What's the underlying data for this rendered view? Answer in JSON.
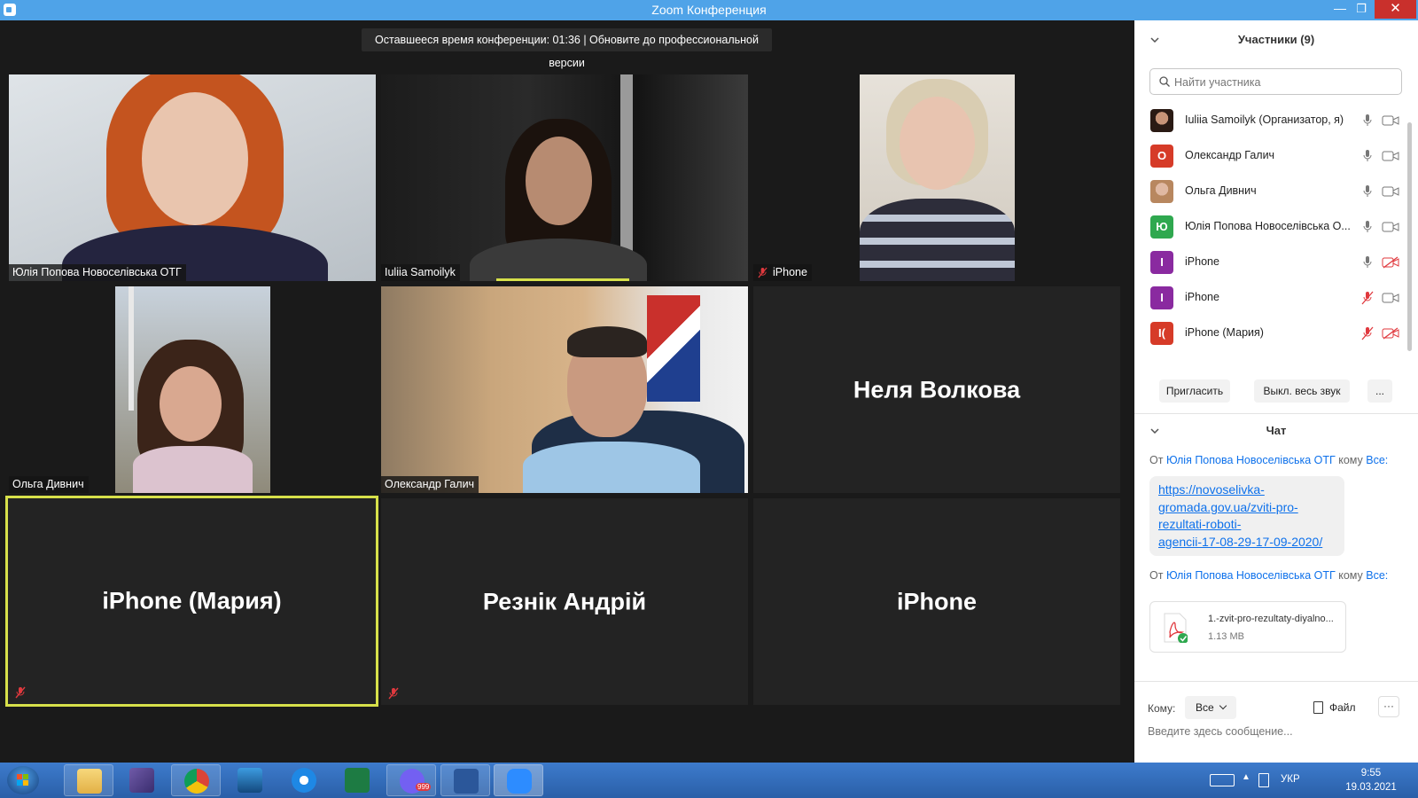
{
  "window": {
    "title": "Zoom Конференция",
    "minimize_glyph": "—",
    "maximize_glyph": "❐",
    "close_glyph": "✕"
  },
  "timebar": {
    "text": "Оставшееся время конференции: 01:36 | Обновите до профессиональной версии"
  },
  "tiles": [
    {
      "name": "Юлія Попова Новоселівська ОТГ",
      "type": "video"
    },
    {
      "name": "Iuliia Samoilyk",
      "type": "video"
    },
    {
      "name": "iPhone",
      "type": "video",
      "muted": true
    },
    {
      "name": "Ольга Дивнич",
      "type": "video"
    },
    {
      "name": "Олександр Галич",
      "type": "video"
    },
    {
      "name": "Неля Волкова",
      "type": "name"
    },
    {
      "name": "iPhone (Мария)",
      "type": "name",
      "muted": true,
      "active_speaker": true
    },
    {
      "name": "Резнік Андрій",
      "type": "name",
      "muted": true
    },
    {
      "name": "iPhone",
      "type": "name"
    }
  ],
  "participants_panel": {
    "title": "Участники (9)",
    "search_placeholder": "Найти участника",
    "participants": [
      {
        "name": "Iuliia Samoilyk (Организатор, я)",
        "avatar": "photo",
        "avatar_color": "#3a2a24",
        "mic": "on",
        "cam": "on"
      },
      {
        "name": "Олександр Галич",
        "avatar_letter": "О",
        "avatar_color": "#d63b28",
        "mic": "on",
        "cam": "on"
      },
      {
        "name": "Ольга Дивнич",
        "avatar": "photo",
        "avatar_color": "#c59a7a",
        "mic": "on",
        "cam": "on"
      },
      {
        "name": "Юлія Попова Новоселівська О...",
        "avatar_letter": "Ю",
        "avatar_color": "#2fa84f",
        "mic": "on",
        "cam": "on"
      },
      {
        "name": "iPhone",
        "avatar_letter": "I",
        "avatar_color": "#8a2aa0",
        "mic": "on",
        "cam": "off"
      },
      {
        "name": "iPhone",
        "avatar_letter": "I",
        "avatar_color": "#8a2aa0",
        "mic": "off",
        "cam": "on"
      },
      {
        "name": "iPhone (Мария)",
        "avatar_letter": "I(",
        "avatar_color": "#d63b28",
        "mic": "off",
        "cam": "off"
      }
    ],
    "invite_label": "Пригласить",
    "mute_all_label": "Выкл. весь звук",
    "more_label": "..."
  },
  "chat": {
    "title": "Чат",
    "messages": [
      {
        "prefix": "От",
        "sender": "Юлія Попова Новоселівська ОТГ",
        "to_word": "кому",
        "recipient": "Все:",
        "link_lines": [
          "https://novoselivka-",
          "gromada.gov.ua/zviti-pro-",
          "rezultati-roboti-",
          "agencii-17-08-29-17-09-2020/"
        ]
      },
      {
        "prefix": "От",
        "sender": "Юлія Попова Новоселівська ОТГ",
        "to_word": "кому",
        "recipient": "Все:",
        "file_name": "1.-zvit-pro-rezultaty-diyalno...",
        "file_size": "1.13 MB"
      }
    ],
    "to_label": "Кому:",
    "to_value": "Все",
    "file_button": "Файл",
    "more_button": "···",
    "input_placeholder": "Введите здесь сообщение..."
  },
  "taskbar": {
    "language": "УКР",
    "time": "9:55",
    "date": "19.03.2021",
    "viber_badge": "999"
  }
}
